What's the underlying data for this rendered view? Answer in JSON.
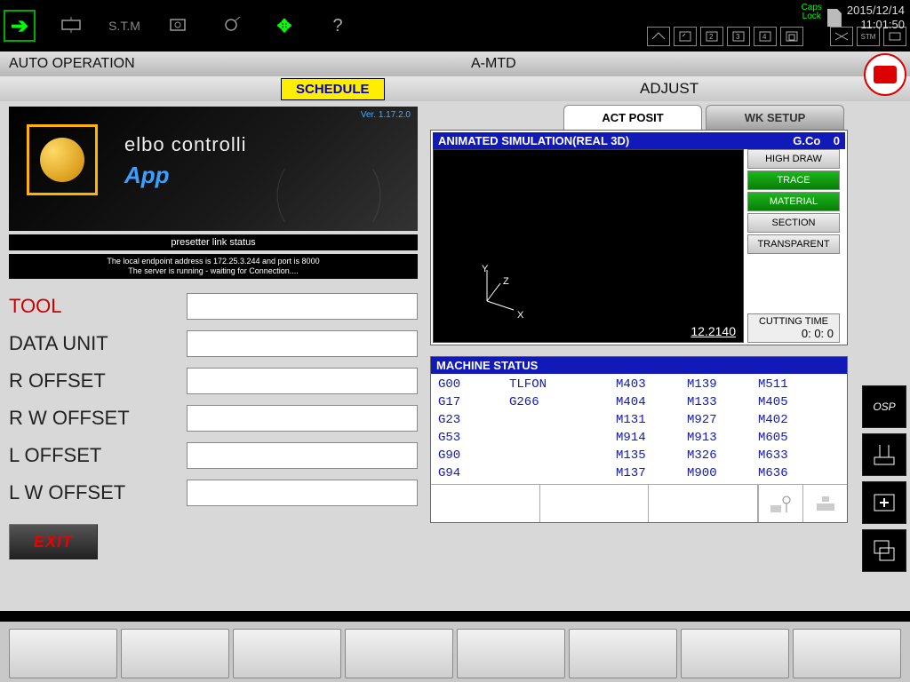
{
  "topbar": {
    "stm": "S.T.M",
    "help": "?",
    "caps": "Caps\nLock",
    "date": "2015/12/14",
    "time": "11:01:50",
    "stm_small": "STM"
  },
  "header": {
    "left": "AUTO OPERATION",
    "right": "A-MTD"
  },
  "tabs": {
    "schedule": "SCHEDULE",
    "adjust": "ADJUST"
  },
  "app": {
    "version": "Ver. 1.17.2.0",
    "title": "elbo controlli",
    "sub": "App",
    "status_title": "presetter link status",
    "status_msg1": "The local endpoint address is 172.25.3.244 and port is 8000",
    "status_msg2": "The server is running - waiting for Connection...."
  },
  "fields": {
    "tool": "TOOL",
    "data_unit": "DATA UNIT",
    "r_offset": "R OFFSET",
    "rw_offset": "R W OFFSET",
    "l_offset": "L OFFSET",
    "lw_offset": "L W OFFSET"
  },
  "exit": "EXIT",
  "right_tabs": {
    "act_posit": "ACT POSIT",
    "wk_setup": "WK SETUP"
  },
  "sim": {
    "title": "ANIMATED SIMULATION(REAL 3D)",
    "gco_label": "G.Co",
    "gco_val": "0",
    "buttons": {
      "high_draw": "HIGH DRAW",
      "trace": "TRACE",
      "material": "MATERIAL",
      "section": "SECTION",
      "transparent": "TRANSPARENT"
    },
    "axes": {
      "x": "X",
      "y": "Y",
      "z": "Z"
    },
    "coord": "12.2140",
    "cut_label": "CUTTING TIME",
    "cut_val": "0: 0: 0"
  },
  "mstatus": {
    "title": "MACHINE STATUS",
    "rows": [
      [
        "G00",
        "TLFON",
        "M403",
        "M139",
        "M511"
      ],
      [
        "G17",
        "G266",
        "M404",
        "M133",
        "M405"
      ],
      [
        "G23",
        "",
        "M131",
        "M927",
        "M402"
      ],
      [
        "G53",
        "",
        "M914",
        "M913",
        "M605"
      ],
      [
        "G90",
        "",
        "M135",
        "M326",
        "M633"
      ],
      [
        "G94",
        "",
        "M137",
        "M900",
        "M636"
      ]
    ]
  }
}
